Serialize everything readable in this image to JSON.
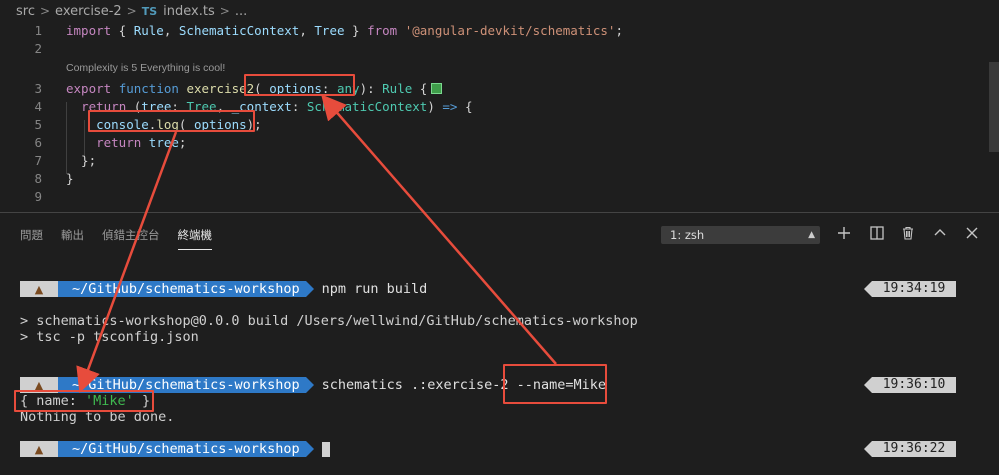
{
  "breadcrumb": {
    "items": [
      "src",
      "exercise-2"
    ],
    "file_badge": "TS",
    "file_name": "index.ts",
    "ellipsis": "..."
  },
  "editor": {
    "codelens": "Complexity is 5 Everything is cool!",
    "lines": [
      {
        "num": "1",
        "tokens": [
          [
            "kw2",
            "import"
          ],
          [
            "pu",
            " { "
          ],
          [
            "pa",
            "Rule"
          ],
          [
            "pu",
            ", "
          ],
          [
            "pa",
            "SchematicContext"
          ],
          [
            "pu",
            ", "
          ],
          [
            "pa",
            "Tree"
          ],
          [
            "pu",
            " } "
          ],
          [
            "kw2",
            "from"
          ],
          [
            "pu",
            " "
          ],
          [
            "st",
            "'@angular-devkit/schematics'"
          ],
          [
            "pu",
            ";"
          ]
        ]
      },
      {
        "num": "2",
        "tokens": []
      },
      {
        "num": "3",
        "tokens": [
          [
            "kw2",
            "export"
          ],
          [
            "pu",
            " "
          ],
          [
            "kw",
            "function"
          ],
          [
            "pu",
            " "
          ],
          [
            "fn",
            "exercise2"
          ],
          [
            "pu",
            "("
          ],
          [
            "pa",
            "_options"
          ],
          [
            "pu",
            ": "
          ],
          [
            "ty",
            "any"
          ],
          [
            "pu",
            "): "
          ],
          [
            "ty",
            "Rule"
          ],
          [
            "pu",
            " {"
          ]
        ]
      },
      {
        "num": "4",
        "tokens": [
          [
            "pu",
            "  "
          ],
          [
            "kw2",
            "return"
          ],
          [
            "pu",
            " ("
          ],
          [
            "pa",
            "tree"
          ],
          [
            "pu",
            ": "
          ],
          [
            "ty",
            "Tree"
          ],
          [
            "pu",
            ", "
          ],
          [
            "pa",
            "_context"
          ],
          [
            "pu",
            ": "
          ],
          [
            "ty",
            "SchematicContext"
          ],
          [
            "pu",
            ") "
          ],
          [
            "kw",
            "=>"
          ],
          [
            "pu",
            " {"
          ]
        ]
      },
      {
        "num": "5",
        "tokens": [
          [
            "pu",
            "    "
          ],
          [
            "pa",
            "console"
          ],
          [
            "pu",
            "."
          ],
          [
            "fn",
            "log"
          ],
          [
            "pu",
            "("
          ],
          [
            "pa",
            "_options"
          ],
          [
            "pu",
            ");"
          ]
        ]
      },
      {
        "num": "6",
        "tokens": [
          [
            "pu",
            "    "
          ],
          [
            "kw2",
            "return"
          ],
          [
            "pu",
            " "
          ],
          [
            "pa",
            "tree"
          ],
          [
            "pu",
            ";"
          ]
        ]
      },
      {
        "num": "7",
        "tokens": [
          [
            "pu",
            "  };"
          ]
        ]
      },
      {
        "num": "8",
        "tokens": [
          [
            "pu",
            "}"
          ]
        ]
      },
      {
        "num": "9",
        "tokens": []
      }
    ]
  },
  "panel": {
    "tabs": [
      "問題",
      "輸出",
      "偵錯主控台",
      "終端機"
    ],
    "active_tab": "終端機",
    "terminal_select": "1: zsh",
    "tool_icons": [
      "plus-icon",
      "split-icon",
      "trash-icon",
      "chevron-up-icon",
      "close-icon"
    ]
  },
  "terminal": {
    "prompt_dir": "~/GitHub/schematics-workshop",
    "prompt_icon": "poop-icon",
    "cmd1": "npm run build",
    "time1": "19:34:19",
    "out1a": "> schematics-workshop@0.0.0 build /Users/wellwind/GitHub/schematics-workshop",
    "out1b": "> tsc -p tsconfig.json",
    "cmd2_prefix": "schematics .:exercise-2 ",
    "cmd2_flag": "--name=Mike",
    "time2": "19:36:10",
    "out2a_pre": "{ name: ",
    "out2a_val": "'Mike'",
    "out2a_post": " }",
    "out2b": "Nothing to be done.",
    "time3": "19:36:22"
  },
  "colors": {
    "annotation": "#e74c3c",
    "prompt_blue": "#2e79c7",
    "string_green": "#3fb950"
  }
}
